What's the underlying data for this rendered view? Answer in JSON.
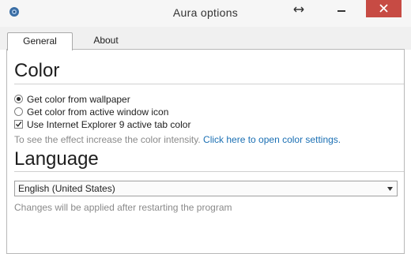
{
  "window": {
    "title": "Aura options",
    "icons": {
      "app": "app-icon",
      "resize": "resize-icon",
      "minimize": "minimize-icon",
      "close": "close-icon"
    },
    "close_color": "#c74b44"
  },
  "tabs": [
    {
      "label": "General",
      "active": true
    },
    {
      "label": "About",
      "active": false
    }
  ],
  "color_section": {
    "title": "Color",
    "options": [
      {
        "type": "radio",
        "label": "Get color from wallpaper",
        "checked": true
      },
      {
        "type": "radio",
        "label": "Get color from active window icon",
        "checked": false
      },
      {
        "type": "checkbox",
        "label": "Use Internet Explorer 9 active tab color",
        "checked": true
      }
    ],
    "hint": "To see the effect increase the color intensity.",
    "link": "Click here to open color settings."
  },
  "language_section": {
    "title": "Language",
    "selected_language": "English (United States)",
    "note": "Changes will be applied after restarting the program"
  },
  "colors": {
    "link": "#1a6fb3",
    "hint": "#8a8a8a"
  }
}
